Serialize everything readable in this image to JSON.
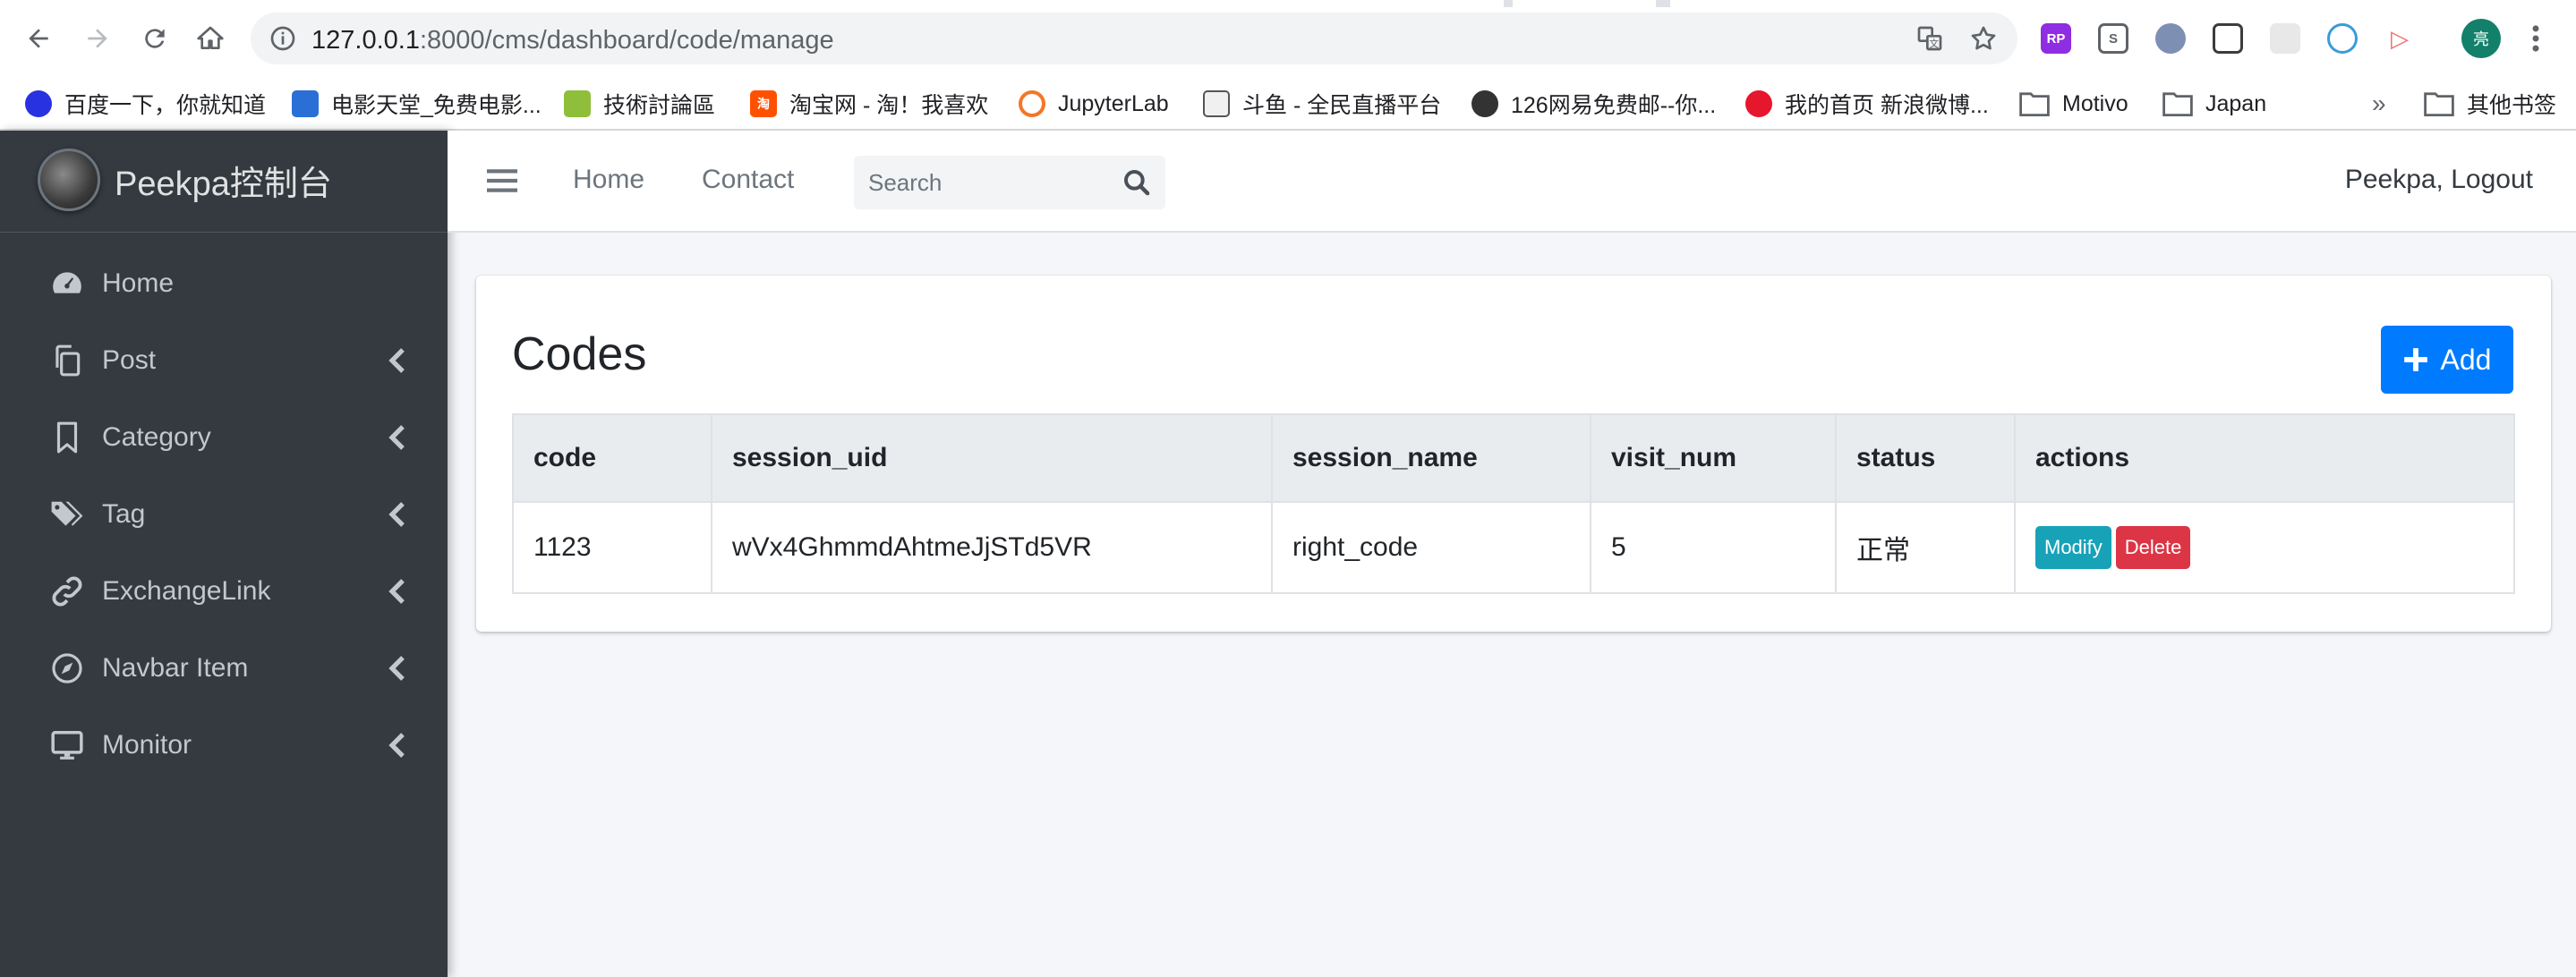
{
  "browser": {
    "url_host": "127.0.0.1",
    "url_rest": ":8000/cms/dashboard/code/manage",
    "profile_initial": "亮",
    "bookmarks": [
      "百度一下，你就知道",
      "电影天堂_免费电影...",
      "技術討論區",
      "淘宝网 - 淘！我喜欢",
      "JupyterLab",
      "斗鱼 - 全民直播平台",
      "126网易免费邮--你...",
      "我的首页 新浪微博...",
      "Motivo",
      "Japan"
    ],
    "more_bookmarks": "»",
    "other_bookmarks": "其他书签"
  },
  "sidebar": {
    "brand": "Peekpa控制台",
    "items": [
      {
        "label": "Home",
        "icon": "dashboard-icon"
      },
      {
        "label": "Post",
        "icon": "copy-icon"
      },
      {
        "label": "Category",
        "icon": "bookmark-icon"
      },
      {
        "label": "Tag",
        "icon": "tags-icon"
      },
      {
        "label": "ExchangeLink",
        "icon": "link-icon"
      },
      {
        "label": "Navbar Item",
        "icon": "compass-icon"
      },
      {
        "label": "Monitor",
        "icon": "desktop-icon"
      }
    ]
  },
  "topnav": {
    "links": [
      "Home",
      "Contact"
    ],
    "search_placeholder": "Search",
    "user": "Peekpa, Logout"
  },
  "main": {
    "title": "Codes",
    "add_label": "Add",
    "columns": [
      "code",
      "session_uid",
      "session_name",
      "visit_num",
      "status",
      "actions"
    ],
    "rows": [
      {
        "code": "1123",
        "session_uid": "wVx4GhmmdAhtmeJjSTd5VR",
        "session_name": "right_code",
        "visit_num": "5",
        "status": "正常",
        "modify": "Modify",
        "delete": "Delete"
      }
    ]
  },
  "colors": {
    "sidebar_bg": "#343a40",
    "primary": "#007bff",
    "info": "#17a2b8",
    "danger": "#dc3545"
  }
}
